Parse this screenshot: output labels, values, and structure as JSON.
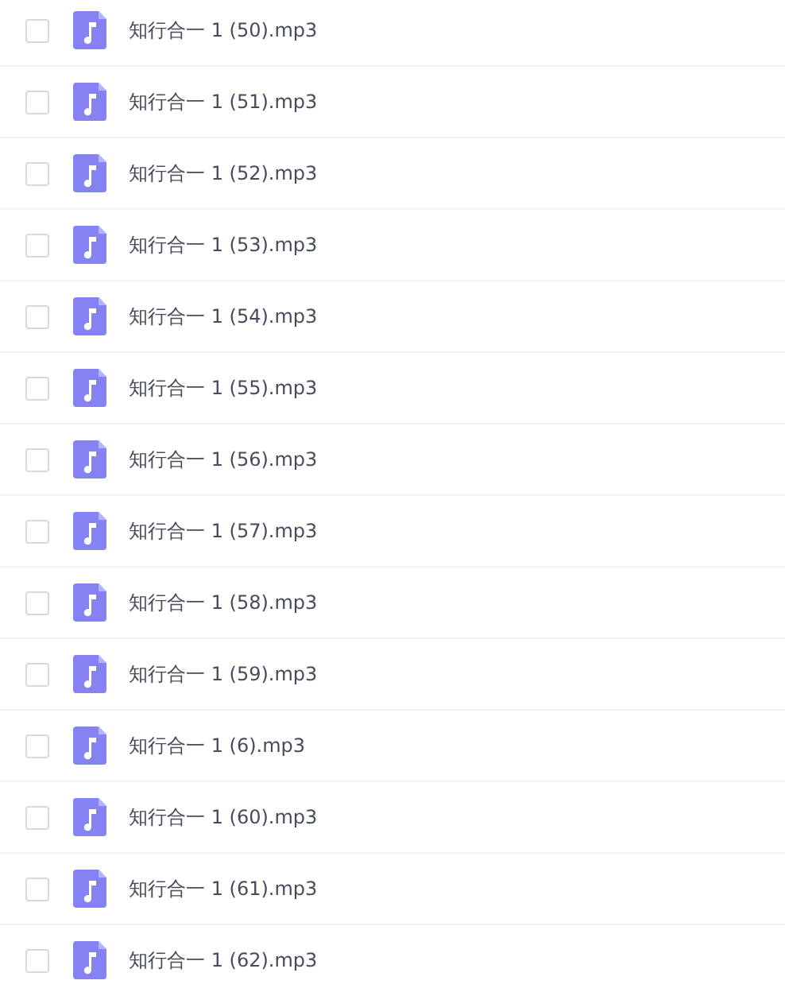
{
  "files": [
    {
      "name": "知行合一 1 (50).mp3",
      "checked": false
    },
    {
      "name": "知行合一 1 (51).mp3",
      "checked": false
    },
    {
      "name": "知行合一 1 (52).mp3",
      "checked": false
    },
    {
      "name": "知行合一 1 (53).mp3",
      "checked": false
    },
    {
      "name": "知行合一 1 (54).mp3",
      "checked": false
    },
    {
      "name": "知行合一 1 (55).mp3",
      "checked": false
    },
    {
      "name": "知行合一 1 (56).mp3",
      "checked": false
    },
    {
      "name": "知行合一 1 (57).mp3",
      "checked": false
    },
    {
      "name": "知行合一 1 (58).mp3",
      "checked": false
    },
    {
      "name": "知行合一 1 (59).mp3",
      "checked": false
    },
    {
      "name": "知行合一 1 (6).mp3",
      "checked": false
    },
    {
      "name": "知行合一 1 (60).mp3",
      "checked": false
    },
    {
      "name": "知行合一 1 (61).mp3",
      "checked": false
    },
    {
      "name": "知行合一 1 (62).mp3",
      "checked": false
    }
  ]
}
